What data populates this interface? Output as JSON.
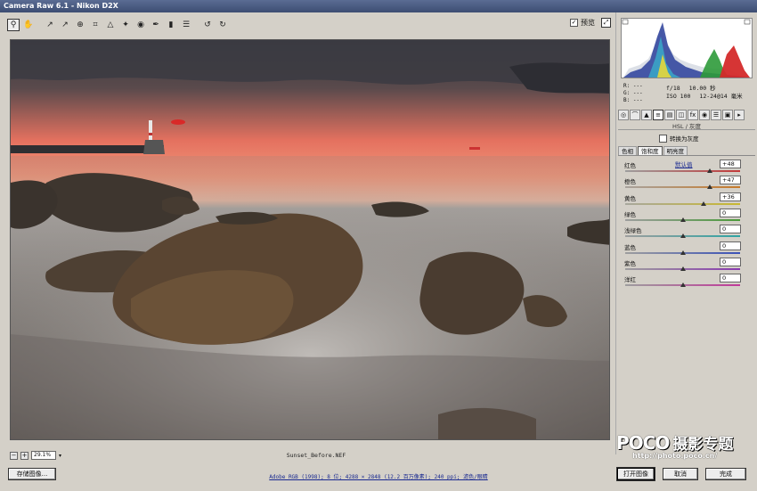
{
  "window": {
    "title": "Camera Raw 6.1 - Nikon D2X"
  },
  "toolbar": {
    "tools": [
      {
        "name": "zoom-tool-icon",
        "glyph": "⚲",
        "active": true
      },
      {
        "name": "hand-tool-icon",
        "glyph": "✋"
      },
      {
        "name": "white-balance-tool-icon",
        "glyph": "↗"
      },
      {
        "name": "color-sampler-tool-icon",
        "glyph": "↗"
      },
      {
        "name": "targeted-adjustment-tool-icon",
        "glyph": "⊕"
      },
      {
        "name": "crop-tool-icon",
        "glyph": "⌗"
      },
      {
        "name": "straighten-tool-icon",
        "glyph": "△"
      },
      {
        "name": "spot-removal-tool-icon",
        "glyph": "✦"
      },
      {
        "name": "red-eye-tool-icon",
        "glyph": "◉"
      },
      {
        "name": "adjustment-brush-icon",
        "glyph": "✒"
      },
      {
        "name": "graduated-filter-icon",
        "glyph": "▮"
      },
      {
        "name": "preferences-icon",
        "glyph": "☰"
      },
      {
        "name": "rotate-ccw-icon",
        "glyph": "↺"
      },
      {
        "name": "rotate-cw-icon",
        "glyph": "↻"
      }
    ],
    "preview_label": "预览",
    "preview_checked": true
  },
  "readout": {
    "r": "R:  ---",
    "g": "G:  ---",
    "b": "B:  ---",
    "aperture": "f/18",
    "shutter": "10.00 秒",
    "iso": "ISO 100",
    "lens": "12-24@14 毫米"
  },
  "panel": {
    "header": "HSL / 灰度",
    "convert_gray_label": "转换为灰度",
    "subtabs": [
      "色相",
      "饱和度",
      "明亮度"
    ],
    "active_subtab": 1,
    "default_link": "默认值",
    "sliders": [
      {
        "label": "红色",
        "value": "+48",
        "fraction": 0.74,
        "track_from": "#9e9e9e",
        "track_to": "#c23a3a"
      },
      {
        "label": "橙色",
        "value": "+47",
        "fraction": 0.74,
        "track_from": "#a8a39e",
        "track_to": "#c77a2a"
      },
      {
        "label": "黄色",
        "value": "+36",
        "fraction": 0.68,
        "track_from": "#a8a89e",
        "track_to": "#c9b830"
      },
      {
        "label": "绿色",
        "value": "0",
        "fraction": 0.5,
        "track_from": "#9e9e9e",
        "track_to": "#4a9a3a"
      },
      {
        "label": "浅绿色",
        "value": "0",
        "fraction": 0.5,
        "track_from": "#9e9e9e",
        "track_to": "#2ea4a4"
      },
      {
        "label": "蓝色",
        "value": "0",
        "fraction": 0.5,
        "track_from": "#9e9e9e",
        "track_to": "#3a52b8"
      },
      {
        "label": "紫色",
        "value": "0",
        "fraction": 0.5,
        "track_from": "#9e9e9e",
        "track_to": "#8a3ab0"
      },
      {
        "label": "洋红",
        "value": "0",
        "fraction": 0.5,
        "track_from": "#9e9e9e",
        "track_to": "#c03a9a"
      }
    ]
  },
  "footer": {
    "zoom": "29.1%",
    "filename": "Sunset_Before.NEF",
    "save_button": "存储图像...",
    "info_link": "Adobe RGB (1998); 8 位; 4288 × 2848 (12.2 百万像素); 240 ppi; 滤色/眼睛",
    "open_button": "打开图像",
    "cancel_button": "取消",
    "done_button": "完成"
  },
  "watermark": {
    "logo": "POCO",
    "cn": "摄影专题",
    "url": "http://photo.poco.cn/"
  }
}
